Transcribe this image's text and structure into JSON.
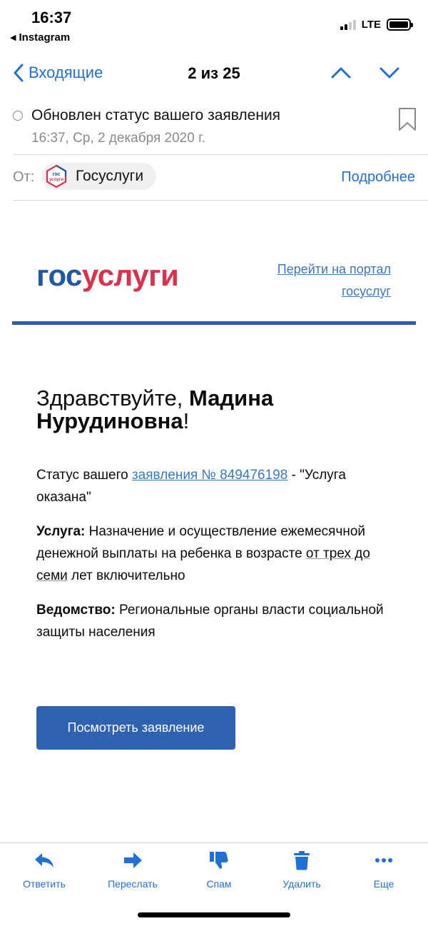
{
  "status_bar": {
    "time": "16:37",
    "back_app": "Instagram",
    "network": "LTE"
  },
  "nav": {
    "back_label": "Входящие",
    "counter": "2 из 25"
  },
  "message": {
    "subject": "Обновлен статус вашего заявления",
    "date": "16:37, Ср, 2 декабря 2020 г.",
    "from_label": "От:",
    "sender_name": "Госуслуги",
    "sender_logo_top": "гос",
    "sender_logo_bottom": "услуги",
    "details_link": "Подробнее"
  },
  "body": {
    "brand_gos": "гос",
    "brand_uslugi": "услуги",
    "portal_link_line1": "Перейти на портал",
    "portal_link_line2": "госуслуг",
    "greeting_prefix": "Здравствуйте, ",
    "greeting_name": "Мадина Нурудиновна",
    "greeting_suffix": "!",
    "status_prefix": "Статус вашего ",
    "status_link": "заявления № 849476198",
    "status_suffix": " - \"Услуга оказана\"",
    "service_label": "Услуга:",
    "service_text_before": " Назначение и осуществление ежемесячной денежной выплаты на ребенка в возрасте ",
    "service_text_underlined": "от трех до семи",
    "service_text_after": " лет включительно",
    "agency_label": "Ведомство:",
    "agency_text": " Региональные органы власти социальной защиты населения",
    "view_button": "Посмотреть заявление"
  },
  "toolbar": {
    "reply": "Ответить",
    "forward": "Переслать",
    "spam": "Спам",
    "delete": "Удалить",
    "more": "Еще"
  },
  "colors": {
    "ios_blue": "#1f6fd6",
    "gos_blue": "#2157a4",
    "gos_red": "#d9324b",
    "button_blue": "#2f63b1"
  }
}
